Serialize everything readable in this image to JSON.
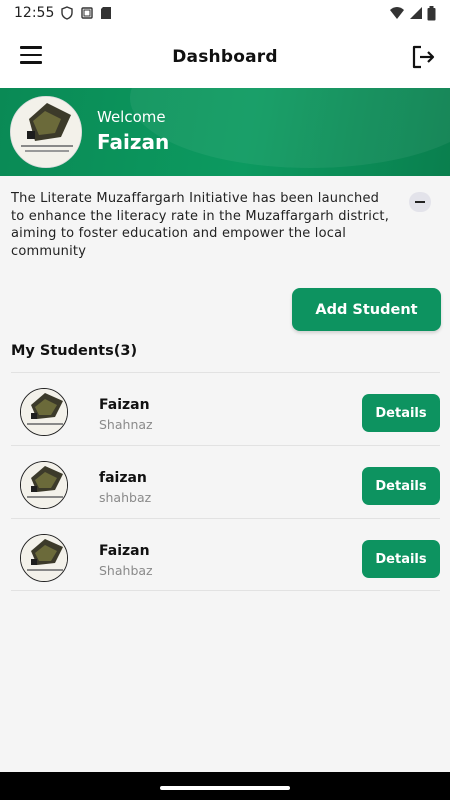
{
  "status_bar": {
    "time": "12:55"
  },
  "appbar": {
    "title": "Dashboard",
    "menu_icon": "hamburger-menu-icon",
    "logout_icon": "logout-icon"
  },
  "banner": {
    "welcome": "Welcome",
    "user_name": "Faizan",
    "color": "#0a8a55"
  },
  "intro_text": "The Literate Muzaffargarh Initiative has been launched to enhance the literacy rate in the Muzaffargarh district, aiming to foster education and empower the local community",
  "add_student_label": "Add Student",
  "students_title": "My Students(3)",
  "accent_color": "#0d9360",
  "students": [
    {
      "name": "Faizan",
      "father": "Shahnaz",
      "action": "Details"
    },
    {
      "name": "faizan",
      "father": "shahbaz",
      "action": "Details"
    },
    {
      "name": "Faizan",
      "father": "Shahbaz",
      "action": "Details"
    }
  ]
}
